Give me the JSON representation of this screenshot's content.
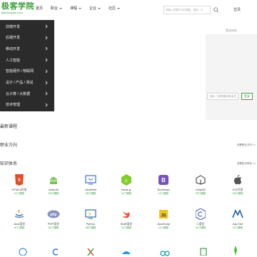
{
  "header": {
    "logo_text": "极客学院",
    "logo_sub": "jikexueyuan.com",
    "nav": [
      {
        "label": "首页",
        "has_caret": false
      },
      {
        "label": "职业",
        "has_caret": true
      },
      {
        "label": "课程",
        "has_caret": true
      },
      {
        "label": "企业",
        "has_caret": true
      },
      {
        "label": "社区",
        "has_caret": true
      }
    ],
    "search_placeholder": "请输入您要学习的课程，例如：iOS开发",
    "user_link": "登录"
  },
  "categories": [
    "前端开发",
    "后端开发",
    "移动开发",
    "人工智能",
    "智能硬件 / 物联网",
    "设计 / 产品 / 测试",
    "云计算 / 大数据",
    "技术管理"
  ],
  "login_card": {
    "title": "登录体验",
    "register_button": "注册 / 立即领取体验会员",
    "login_button": "登录"
  },
  "sections": {
    "latest": "最新课程",
    "career": "职业方向",
    "career_more": "查看职业方向 >>",
    "knowledge": "知识体系",
    "knowledge_more": "查看知识体系 >>"
  },
  "courses_row1": [
    {
      "name": "HTML5开发",
      "count": "11门课程",
      "icon": "html5-icon"
    },
    {
      "name": "Android",
      "count": "59门课程",
      "icon": "android-icon"
    },
    {
      "name": "JavaWeb",
      "count": "65门课程",
      "icon": "javaweb-icon"
    },
    {
      "name": "Node.js",
      "count": "11门课程",
      "icon": "nodejs-icon"
    },
    {
      "name": "Bootstrap",
      "count": "11门课程",
      "icon": "bootstrap-icon"
    },
    {
      "name": "Unity3D",
      "count": "30门课程",
      "icon": "unity-icon"
    },
    {
      "name": "iOS开发",
      "count": "65门课程",
      "icon": "apple-icon"
    }
  ],
  "courses_row2": [
    {
      "name": "Java语言",
      "count": "61门课程",
      "icon": "java-icon"
    },
    {
      "name": "PHP语言",
      "count": "81门课程",
      "icon": "php-icon"
    },
    {
      "name": "Python",
      "count": "88门课程",
      "icon": "python-icon"
    },
    {
      "name": "Swift语言",
      "count": "11门课程",
      "icon": "swift-icon"
    },
    {
      "name": "JavaScript",
      "count": "11门课程",
      "icon": "javascript-icon"
    },
    {
      "name": "C语言",
      "count": "31门课程",
      "icon": "c-icon"
    },
    {
      "name": "Asp.Net",
      "count": "11门课程",
      "icon": "aspnet-icon"
    }
  ],
  "colors": {
    "brand_green": "#3aa24a",
    "menu_bg": "#2b2b2b",
    "html5_orange": "#e44d26",
    "bootstrap_purple": "#7952b3",
    "swift_orange": "#f05138",
    "js_yellow": "#f0c419",
    "python_blue": "#3572a5",
    "java_blue": "#2f74c0"
  }
}
